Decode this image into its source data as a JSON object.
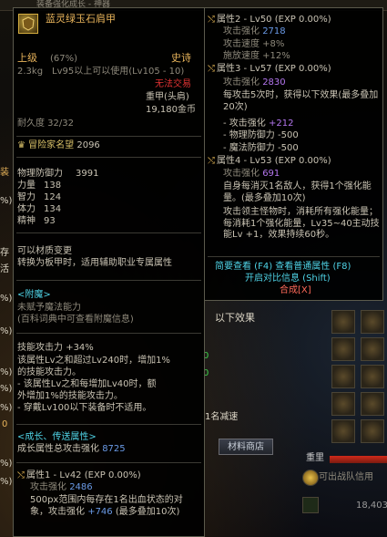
{
  "background": {
    "topbar_text": "装备强化成长 - 神器",
    "left_fragments": [
      "装",
      "%)",
      "存",
      "活",
      "%)",
      "%)",
      "%)",
      "%)",
      "%)",
      "0",
      "%)",
      "%)"
    ],
    "mid_texts": [
      "以下效果",
      "0",
      "0",
      "1名减速"
    ],
    "shop_button": "材料商店",
    "hp_label": "重里",
    "bottom_text": "可出战队信用",
    "bottom_number": "18,403"
  },
  "tooltip": {
    "item_name": "蓝灵绿玉石肩甲",
    "grade_label": "上级",
    "grade_pct": "(67%)",
    "rarity": "史诗",
    "weight": "2.3kg",
    "level_req": "Lv95以上可以使用(Lv105 - 10)",
    "tradeable": "无法交易",
    "type": "重甲(头肩)",
    "price": "19,180金币",
    "durability": "耐久度 32/32",
    "adventurer_label": "冒险家名望",
    "adventurer_value": "2096",
    "stats": [
      {
        "label": "物理防御力",
        "value": "3991"
      },
      {
        "label": "力量",
        "value": "138"
      },
      {
        "label": "智力",
        "value": "124"
      },
      {
        "label": "体力",
        "value": "134"
      },
      {
        "label": "精神",
        "value": "93"
      }
    ],
    "material_change": "可以材质变更",
    "convert_note": "转换为板甲时，适用辅助职业专属属性",
    "enchant_header": "<附魔>",
    "enchant_none": "未赋予魔法能力",
    "enchant_hint": "(百科词典中可查看附魔信息)",
    "skill_atk_label": "技能攻击力",
    "skill_atk_value": "+34%",
    "skill_desc_lines": [
      "该属性Lv之和超过Lv240时，增加1%",
      "的技能攻击力。",
      "- 该属性Lv之和每增加Lv40时，额",
      "外增加1%的技能攻击力。",
      "- 穿戴Lv100以下装备时不适用。"
    ],
    "growth_header": "<成长、传送属性>",
    "growth_total_label": "成长属性总攻击强化",
    "growth_total_value": "8725",
    "attr1_title": "属性1 - Lv42 (EXP 0.00%)",
    "attr1_lines": [
      {
        "label": "攻击强化",
        "value": "2486"
      }
    ],
    "attr1_desc": "500px范围内每存在1名出血状态的对象，攻击强化",
    "attr1_bonus": "+746",
    "attr1_tail": "(最多叠加10次)"
  },
  "side_panel": {
    "attr2_title": "属性2 - Lv50 (EXP 0.00%)",
    "attr2_atk_label": "攻击强化",
    "attr2_atk_value": "2718",
    "attr2_lines": [
      "攻击速度 +8%",
      "施放速度 +12%"
    ],
    "attr3_title": "属性3 - Lv57 (EXP 0.00%)",
    "attr3_atk_label": "攻击强化",
    "attr3_atk_value": "2830",
    "attr3_desc": "每攻击5次时，获得以下效果(最多叠加20次)",
    "attr3_effects": [
      {
        "label": "- 攻击强化",
        "value": "+212",
        "color": "#b476ee"
      },
      {
        "label": "- 物理防御力",
        "value": "-500",
        "color": "#c9c3b3"
      },
      {
        "label": "- 魔法防御力",
        "value": "-500",
        "color": "#c9c3b3"
      }
    ],
    "attr4_title": "属性4 - Lv53 (EXP 0.00%)",
    "attr4_atk_label": "攻击强化",
    "attr4_atk_value": "691",
    "attr4_desc1": "自身每消灭1名敌人，获得1个强化能量。(最多叠加10次)",
    "attr4_desc2": "攻击领主怪物时，消耗所有强化能量；每消耗1个强化能量，Lv35~40主动技能Lv +1，效果持续60秒。",
    "link_brief": "简要查看 (F4) 查看普通属性 (F8)",
    "link_compare": "开启对比信息 (Shift)",
    "link_compose": "合成[X]"
  }
}
